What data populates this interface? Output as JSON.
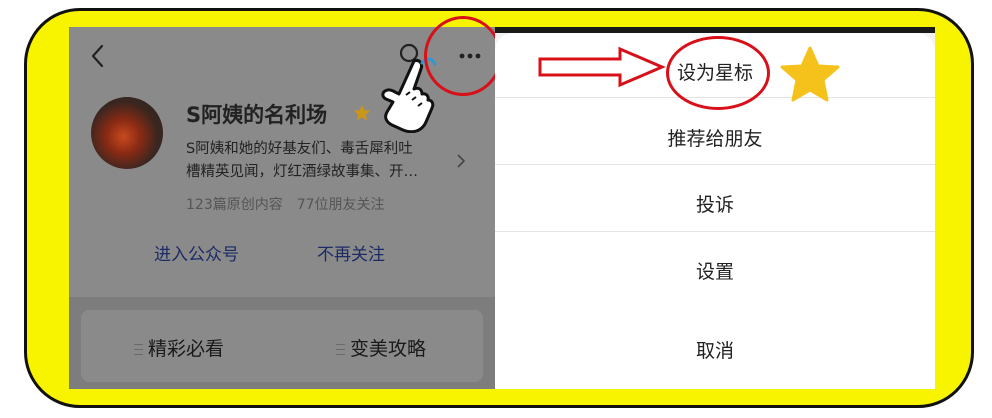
{
  "colors": {
    "frame": "#f8f400",
    "overlay": "#8a8a8a",
    "link": "#1c2a66",
    "annotation_red": "#d8101a",
    "star": "#f5c21b"
  },
  "header": {
    "icons": [
      "back-arrow-icon",
      "search-icon",
      "more-dots-icon"
    ]
  },
  "profile": {
    "name": "S阿姨的名利场",
    "description_line1": "S阿姨和她的好基友们、毒舌犀利吐",
    "description_line2": "槽精英见闻，灯红酒绿故事集、开…",
    "original_count": "123篇原创内容",
    "friends_following": "77位朋友关注",
    "enter_label": "进入公众号",
    "unfollow_label": "不再关注"
  },
  "menu": {
    "items": [
      "精彩必看",
      "变美攻略"
    ]
  },
  "action_sheet": {
    "items": [
      "设为星标",
      "推荐给朋友",
      "投诉",
      "设置"
    ],
    "cancel": "取消"
  }
}
